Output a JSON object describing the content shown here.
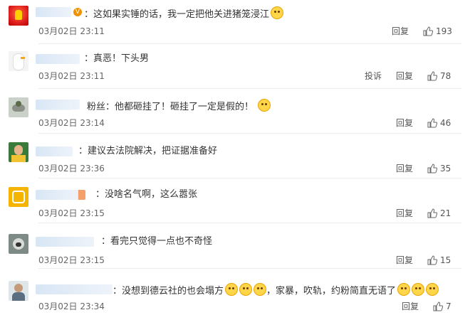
{
  "comments": [
    {
      "text": "：这如果实锤的话，我一定把他关进猪笼浸江",
      "time": "03月02日 23:11",
      "actions": [
        "回复"
      ],
      "likes": "193",
      "emoji": [
        "laugh-emoji"
      ]
    },
    {
      "text": "：真恶！下头男",
      "time": "03月02日 23:11",
      "actions": [
        "投诉",
        "回复"
      ],
      "likes": "78",
      "emoji": []
    },
    {
      "text": "粉丝：他都砸挂了！砸挂了一定是假的！",
      "time": "03月02日 23:14",
      "actions": [
        "回复"
      ],
      "likes": "46",
      "emoji": [
        "shocked-emoji"
      ]
    },
    {
      "text": "：建议去法院解决，把证据准备好",
      "time": "03月02日 23:36",
      "actions": [
        "回复"
      ],
      "likes": "35",
      "emoji": []
    },
    {
      "text": "：没啥名气啊，这么嚣张",
      "time": "03月02日 23:15",
      "actions": [
        "回复"
      ],
      "likes": "21",
      "emoji": []
    },
    {
      "text": "：看完只觉得一点也不奇怪",
      "time": "03月02日 23:15",
      "actions": [
        "回复"
      ],
      "likes": "15",
      "emoji": []
    },
    {
      "text_a": "：没想到德云社的也会塌方",
      "text_b": "，家暴，吹轨，约粉简直无语了",
      "time": "03月02日 23:34",
      "actions": [
        "回复"
      ],
      "likes": "7",
      "emoji": [
        "cry-laugh-emoji",
        "cry-laugh-emoji",
        "cry-laugh-emoji",
        "yawn-emoji",
        "yawn-emoji",
        "yawn-emoji"
      ]
    }
  ],
  "colors": {
    "text": "#333333",
    "meta": "#666666",
    "name_placeholder": "#d8e6f5",
    "vip_badge": "#f29100"
  }
}
